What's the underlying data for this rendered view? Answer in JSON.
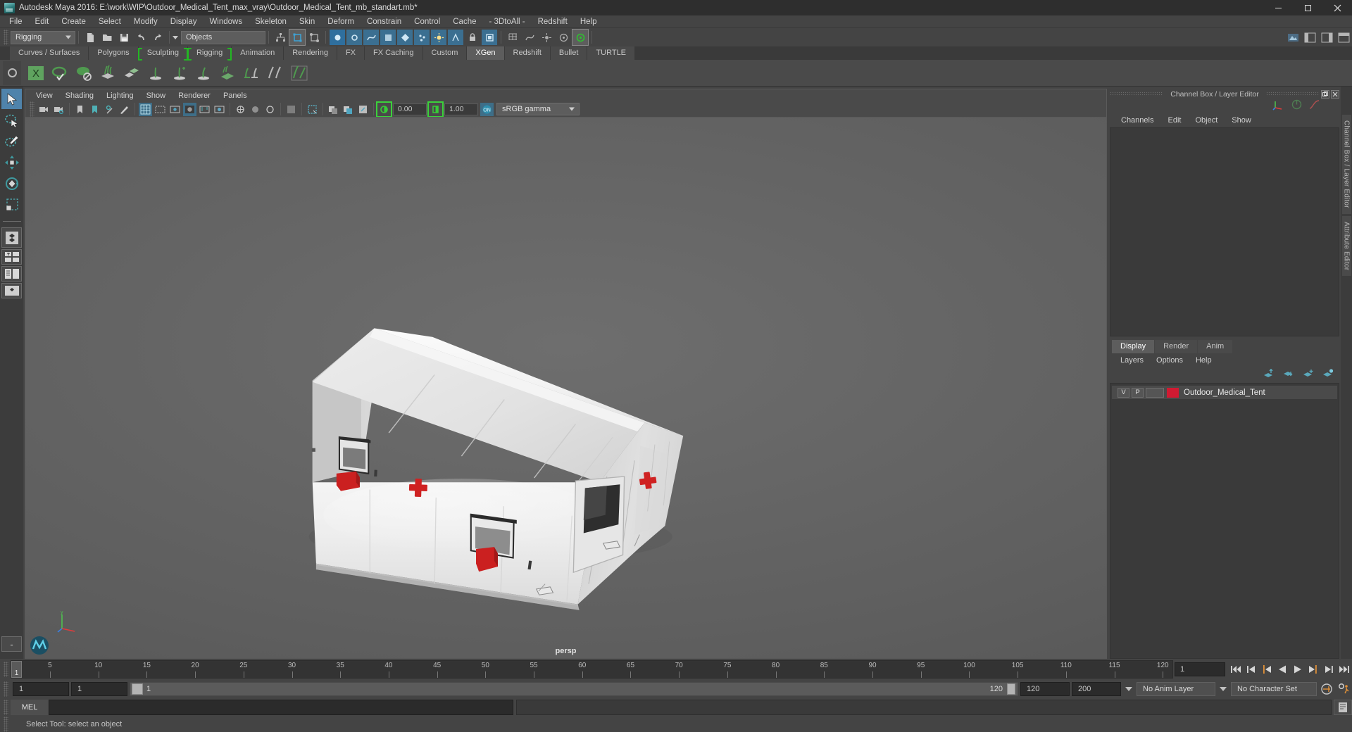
{
  "window": {
    "title": "Autodesk Maya 2016: E:\\work\\WIP\\Outdoor_Medical_Tent_max_vray\\Outdoor_Medical_Tent_mb_standart.mb*",
    "minimize": "–",
    "maximize": "❐",
    "close": "✕"
  },
  "menubar": {
    "items": [
      {
        "label": "File"
      },
      {
        "label": "Edit"
      },
      {
        "label": "Create"
      },
      {
        "label": "Select"
      },
      {
        "label": "Modify"
      },
      {
        "label": "Display"
      },
      {
        "label": "Windows"
      },
      {
        "label": "Skeleton"
      },
      {
        "label": "Skin"
      },
      {
        "label": "Deform"
      },
      {
        "label": "Constrain"
      },
      {
        "label": "Control"
      },
      {
        "label": "Cache"
      },
      {
        "label": "- 3DtoAll -"
      },
      {
        "label": "Redshift"
      },
      {
        "label": "Help"
      }
    ]
  },
  "statusline": {
    "menuset": "Rigging",
    "selection_mask": "Objects"
  },
  "shelf": {
    "tabs": [
      {
        "label": "Curves / Surfaces",
        "selected": false,
        "bracket": false
      },
      {
        "label": "Polygons",
        "selected": false,
        "bracket": false
      },
      {
        "label": "Sculpting",
        "selected": false,
        "bracket": true
      },
      {
        "label": "Rigging",
        "selected": false,
        "bracket": true
      },
      {
        "label": "Animation",
        "selected": false,
        "bracket": false
      },
      {
        "label": "Rendering",
        "selected": false,
        "bracket": false
      },
      {
        "label": "FX",
        "selected": false,
        "bracket": false
      },
      {
        "label": "FX Caching",
        "selected": false,
        "bracket": false
      },
      {
        "label": "Custom",
        "selected": false,
        "bracket": false
      },
      {
        "label": "XGen",
        "selected": true,
        "bracket": false
      },
      {
        "label": "Redshift",
        "selected": false,
        "bracket": false
      },
      {
        "label": "Bullet",
        "selected": false,
        "bracket": false
      },
      {
        "label": "TURTLE",
        "selected": false,
        "bracket": false
      }
    ]
  },
  "panel": {
    "menu": [
      {
        "label": "View"
      },
      {
        "label": "Shading"
      },
      {
        "label": "Lighting"
      },
      {
        "label": "Show"
      },
      {
        "label": "Renderer"
      },
      {
        "label": "Panels"
      }
    ],
    "exposure_value": "0.00",
    "gamma_value": "1.00",
    "color_management": "sRGB gamma",
    "camera_label": "persp"
  },
  "channelbox": {
    "title": "Channel Box / Layer Editor",
    "menu": [
      {
        "label": "Channels"
      },
      {
        "label": "Edit"
      },
      {
        "label": "Object"
      },
      {
        "label": "Show"
      }
    ]
  },
  "layer_editor": {
    "tabs": [
      {
        "label": "Display",
        "selected": true
      },
      {
        "label": "Render",
        "selected": false
      },
      {
        "label": "Anim",
        "selected": false
      }
    ],
    "menu": [
      {
        "label": "Layers"
      },
      {
        "label": "Options"
      },
      {
        "label": "Help"
      }
    ],
    "layers": [
      {
        "visibility": "V",
        "playback": "P",
        "color": "#d01a32",
        "name": "Outdoor_Medical_Tent"
      }
    ]
  },
  "right_tabs": [
    {
      "label": "Channel Box / Layer Editor"
    },
    {
      "label": "Attribute Editor"
    }
  ],
  "timeline": {
    "current_frame_label": "1",
    "ticks": [
      5,
      10,
      15,
      20,
      25,
      30,
      35,
      40,
      45,
      50,
      55,
      60,
      65,
      70,
      75,
      80,
      85,
      90,
      95,
      100,
      105,
      110,
      115,
      120
    ],
    "start": 1,
    "end": 120,
    "current_frame_field": "1"
  },
  "range_slider": {
    "anim_start": "1",
    "range_start": "1",
    "bar_label": "1",
    "bar_end_label": "120",
    "range_end": "120",
    "anim_end": "200",
    "anim_layer": "No Anim Layer",
    "character_set": "No Character Set"
  },
  "command_line": {
    "language_tab": "MEL",
    "input_value": "",
    "output_value": ""
  },
  "help_line": {
    "text": "Select Tool: select an object"
  },
  "icons": {
    "select_tool": "arrow-cursor-icon",
    "lasso_tool": "lasso-select-icon",
    "paint_select": "paint-select-icon",
    "move_tool": "move-tool-icon",
    "rotate_tool": "rotate-tool-icon",
    "scale_tool": "scale-tool-icon"
  },
  "colors": {
    "accent_blue": "#4f83ab",
    "shelf_green": "#23b723",
    "layer_red": "#d01a32",
    "panel_bg": "#444444",
    "viewport_bg": "#5f5f5f",
    "playhead_orange": "#e08a2e"
  }
}
